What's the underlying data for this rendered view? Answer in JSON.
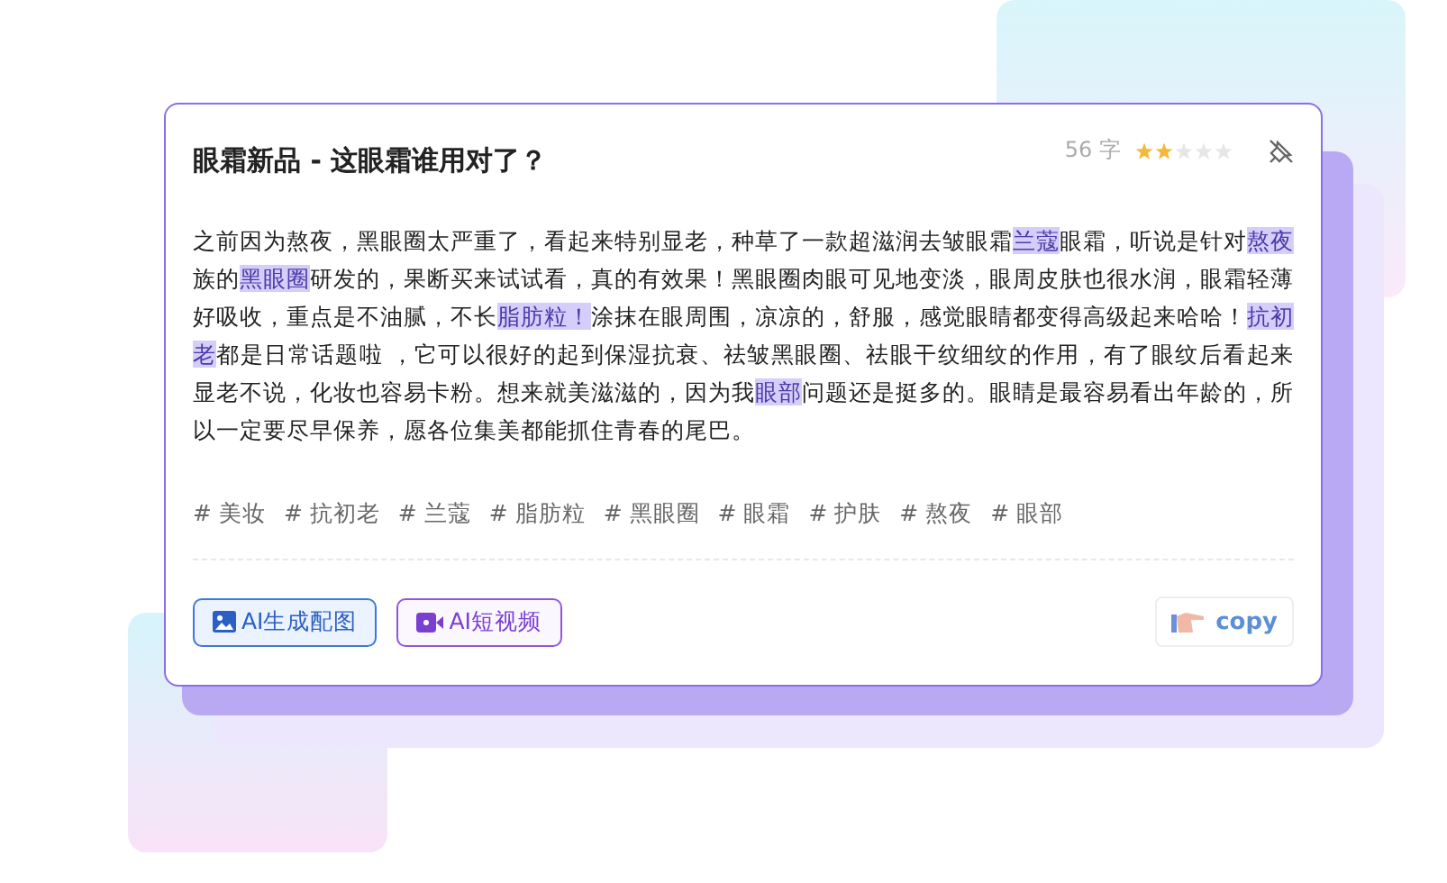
{
  "title": "眼霜新品 - 这眼霜谁用对了？",
  "word_count": "56 字",
  "stars": 2,
  "body": [
    {
      "text": "之前因为熬夜，黑眼圈太严重了，看起来特别显老，种草了一款超滋润去皱眼霜",
      "highlighted": false
    },
    {
      "text": "兰蔻",
      "highlighted": true
    },
    {
      "text": "眼霜，听说是针对",
      "highlighted": false
    },
    {
      "text": "熬夜",
      "highlighted": true
    },
    {
      "text": "族的",
      "highlighted": false
    },
    {
      "text": "黑眼圈",
      "highlighted": true
    },
    {
      "text": "研发的，果断买来试试看，真的有效果！黑眼圈肉眼可见地变淡，眼周皮肤也很水润，眼霜轻薄好吸收，重点是不油腻，不长",
      "highlighted": false
    },
    {
      "text": "脂肪粒！",
      "highlighted": true
    },
    {
      "text": "涂抹在眼周围，凉凉的，舒服，感觉眼睛都变得高级起来哈哈！",
      "highlighted": false
    },
    {
      "text": "抗初老",
      "highlighted": true
    },
    {
      "text": "都是日常话题啦 ，它可以很好的起到保湿抗衰、祛皱黑眼圈、祛眼干纹细纹的作用，有了眼纹后看起来显老不说，化妆也容易卡粉。想来就美滋滋的，因为我",
      "highlighted": false
    },
    {
      "text": "眼部",
      "highlighted": true
    },
    {
      "text": "问题还是挺多的。眼睛是最容易看出年龄的，所以一定要尽早保养，愿各位集美都能抓住青春的尾巴。",
      "highlighted": false
    }
  ],
  "tags": [
    "# 美妆",
    "# 抗初老",
    "# 兰蔻",
    "# 脂肪粒",
    "# 黑眼圈",
    "# 眼霜",
    "# 护肤",
    "# 熬夜",
    "# 眼部"
  ],
  "buttons": [
    {
      "kind": "image",
      "label": "AI生成配图"
    },
    {
      "kind": "video",
      "label": "AI短视频"
    }
  ],
  "copy_button": "copy"
}
